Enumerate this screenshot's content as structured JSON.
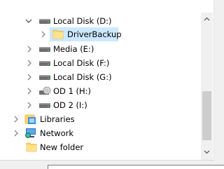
{
  "tree": {
    "items": [
      {
        "label": "Local Disk (D:)",
        "icon": "drive-icon"
      },
      {
        "label": "DriverBackup",
        "icon": "folder-icon"
      },
      {
        "label": "Media (E:)",
        "icon": "drive-icon"
      },
      {
        "label": "Local Disk (F:)",
        "icon": "drive-icon"
      },
      {
        "label": "Local Disk (G:)",
        "icon": "drive-icon"
      },
      {
        "label": "OD 1 (H:)",
        "icon": "optical-drive-icon"
      },
      {
        "label": "OD 2 (I:)",
        "icon": "drive-icon"
      },
      {
        "label": "Libraries",
        "icon": "libraries-icon"
      },
      {
        "label": "Network",
        "icon": "network-icon"
      },
      {
        "label": "New folder",
        "icon": "folder-icon"
      }
    ]
  },
  "colors": {
    "selection": "#cce8ff",
    "folder": "#ffd866",
    "scroll_thumb": "#cdcdcd"
  }
}
